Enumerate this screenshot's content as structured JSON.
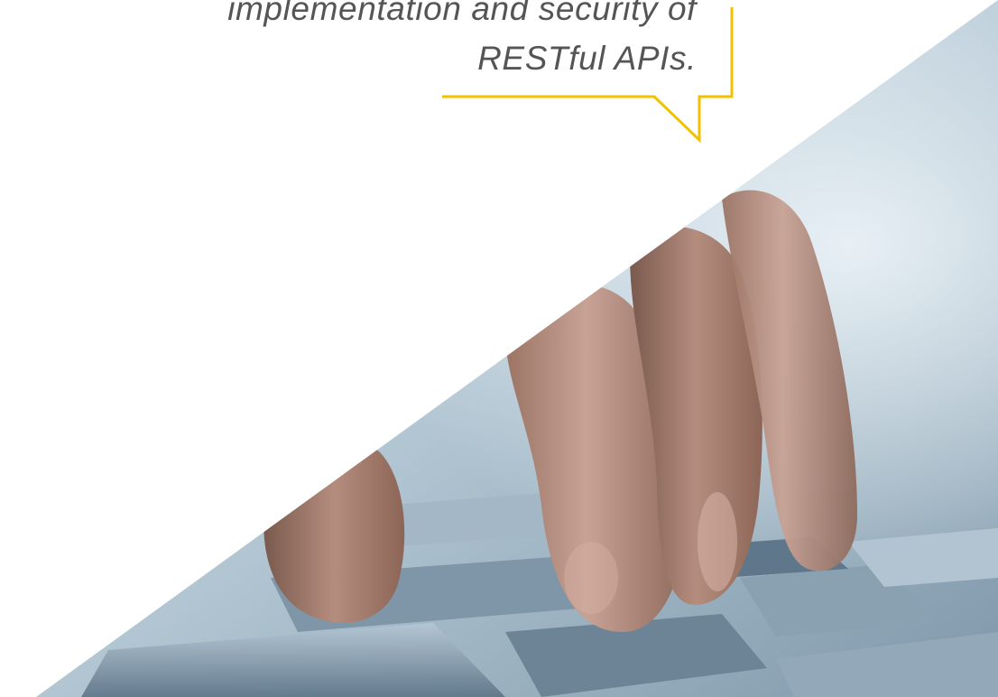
{
  "quote": {
    "line1": "implementation and security of",
    "line2": "RESTful APIs."
  },
  "colors": {
    "bubble_accent": "#f2c200",
    "quote_text": "#555555",
    "background": "#ffffff"
  },
  "icons": {
    "bubble": "speech-bubble-icon"
  }
}
